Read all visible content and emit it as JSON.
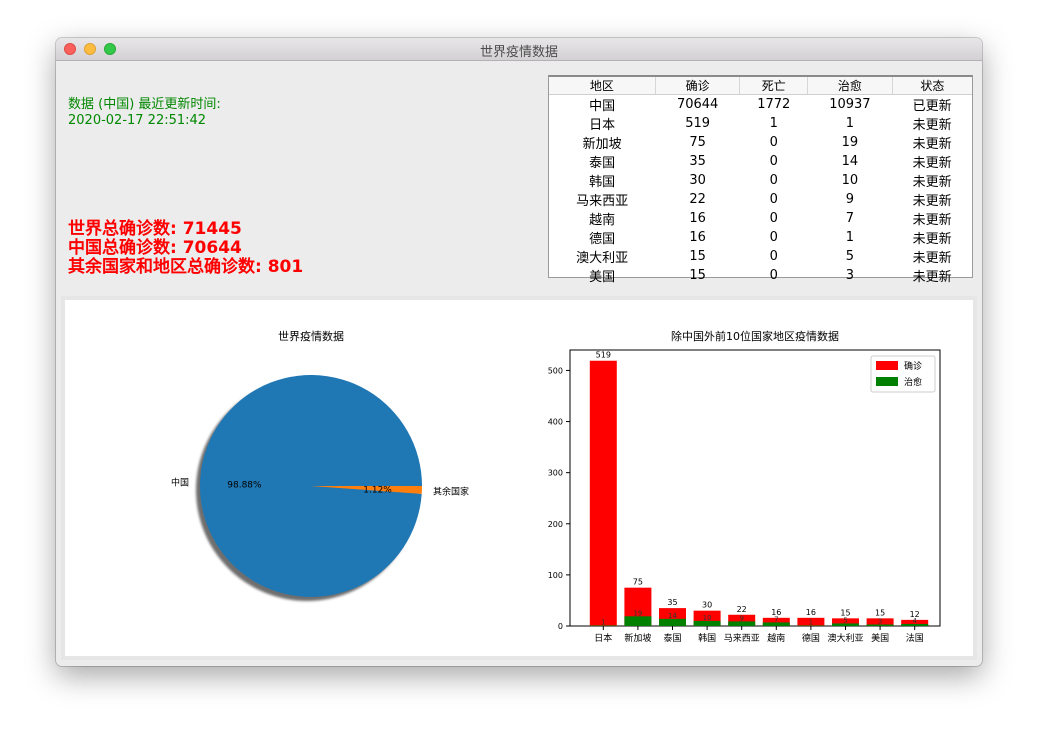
{
  "window": {
    "title": "世界疫情数据"
  },
  "info": {
    "update_label": "数据 (中国) 最近更新时间:",
    "update_time": "2020-02-17 22:51:42",
    "world_total": "世界总确诊数: 71445",
    "china_total": "中国总确诊数: 70644",
    "other_total": "其余国家和地区总确诊数: 801"
  },
  "table": {
    "headers": [
      "地区",
      "确诊",
      "死亡",
      "治愈",
      "状态"
    ],
    "rows": [
      [
        "中国",
        "70644",
        "1772",
        "10937",
        "已更新"
      ],
      [
        "日本",
        "519",
        "1",
        "1",
        "未更新"
      ],
      [
        "新加坡",
        "75",
        "0",
        "19",
        "未更新"
      ],
      [
        "泰国",
        "35",
        "0",
        "14",
        "未更新"
      ],
      [
        "韩国",
        "30",
        "0",
        "10",
        "未更新"
      ],
      [
        "马来西亚",
        "22",
        "0",
        "9",
        "未更新"
      ],
      [
        "越南",
        "16",
        "0",
        "7",
        "未更新"
      ],
      [
        "德国",
        "16",
        "0",
        "1",
        "未更新"
      ],
      [
        "澳大利亚",
        "15",
        "0",
        "5",
        "未更新"
      ],
      [
        "美国",
        "15",
        "0",
        "3",
        "未更新"
      ]
    ]
  },
  "chart_data": [
    {
      "type": "pie",
      "title": "世界疫情数据",
      "labels": [
        "中国",
        "其余国家"
      ],
      "values": [
        70644,
        801
      ],
      "percent_labels": [
        "98.88%",
        "1.12%"
      ],
      "colors": [
        "#1f77b4",
        "#ff7f0e"
      ]
    },
    {
      "type": "bar",
      "title": "除中国外前10位国家地区疫情数据",
      "categories": [
        "日本",
        "新加坡",
        "泰国",
        "韩国",
        "马来西亚",
        "越南",
        "德国",
        "澳大利亚",
        "美国",
        "法国"
      ],
      "series": [
        {
          "name": "确诊",
          "values": [
            519,
            75,
            35,
            30,
            22,
            16,
            16,
            15,
            15,
            12
          ],
          "color": "#ff0000"
        },
        {
          "name": "治愈",
          "values": [
            1,
            19,
            14,
            10,
            9,
            7,
            1,
            5,
            3,
            4
          ],
          "color": "#008000"
        }
      ],
      "ylim": [
        0,
        540
      ],
      "yticks": [
        0,
        100,
        200,
        300,
        400,
        500
      ],
      "legend": "top-right"
    }
  ]
}
